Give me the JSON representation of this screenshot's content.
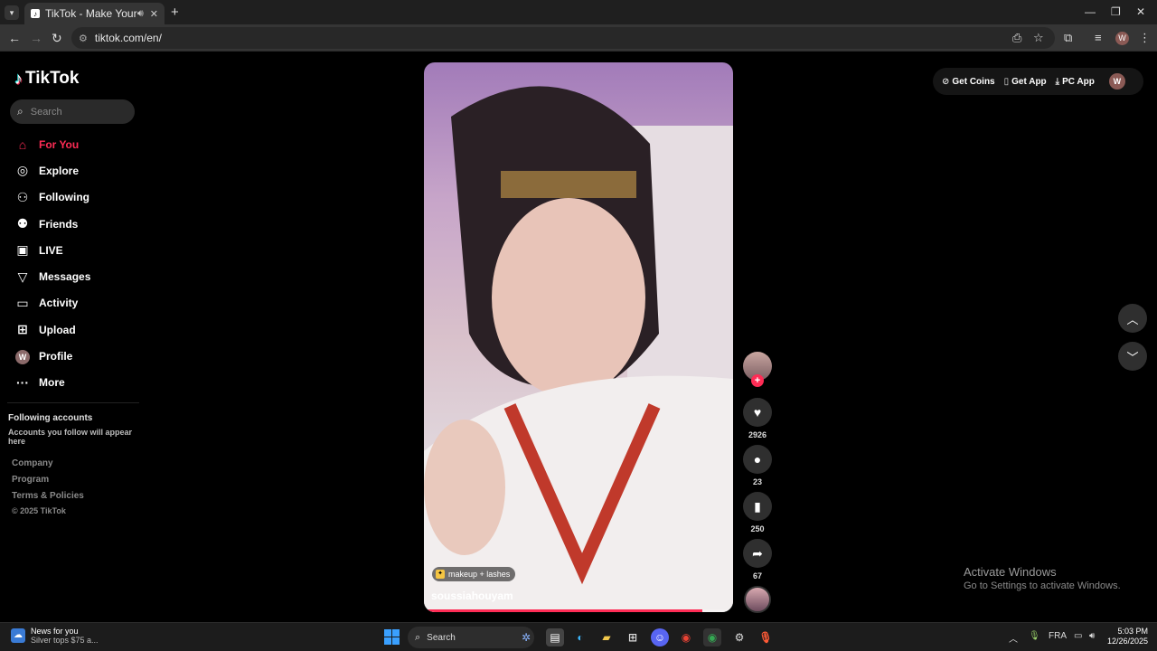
{
  "browser": {
    "tab_title": "TikTok - Make Your Day",
    "url": "tiktok.com/en/",
    "profile_initial": "W"
  },
  "sidebar": {
    "logo_text": "TikTok",
    "search_placeholder": "Search",
    "items": [
      {
        "label": "For You",
        "icon": "home-icon",
        "active": true
      },
      {
        "label": "Explore",
        "icon": "compass-icon"
      },
      {
        "label": "Following",
        "icon": "following-icon"
      },
      {
        "label": "Friends",
        "icon": "friends-icon"
      },
      {
        "label": "LIVE",
        "icon": "live-icon"
      },
      {
        "label": "Messages",
        "icon": "send-icon"
      },
      {
        "label": "Activity",
        "icon": "activity-icon"
      },
      {
        "label": "Upload",
        "icon": "upload-icon"
      },
      {
        "label": "Profile",
        "icon": "avatar",
        "initial": "W"
      },
      {
        "label": "More",
        "icon": "more-icon"
      }
    ],
    "following_title": "Following accounts",
    "following_sub": "Accounts you follow will appear here",
    "footer": [
      "Company",
      "Program",
      "Terms & Policies"
    ],
    "copyright": "© 2025 TikTok"
  },
  "topright": {
    "get_coins": "Get Coins",
    "get_app": "Get App",
    "pc_app": "PC App",
    "avatar_initial": "W"
  },
  "video": {
    "effect": "makeup + lashes",
    "author": "soussiahouyam",
    "progress": 0.9
  },
  "actions": {
    "likes": "2926",
    "comments": "23",
    "saves": "250",
    "shares": "67"
  },
  "watermark": {
    "line1": "Activate Windows",
    "line2": "Go to Settings to activate Windows."
  },
  "taskbar": {
    "news_title": "News for you",
    "news_sub": "Silver tops $75 a...",
    "search": "Search",
    "lang": "FRA",
    "time": "5:03 PM",
    "date": "12/26/2025"
  },
  "colors": {
    "accent": "#fe2c55",
    "background": "#000000"
  }
}
